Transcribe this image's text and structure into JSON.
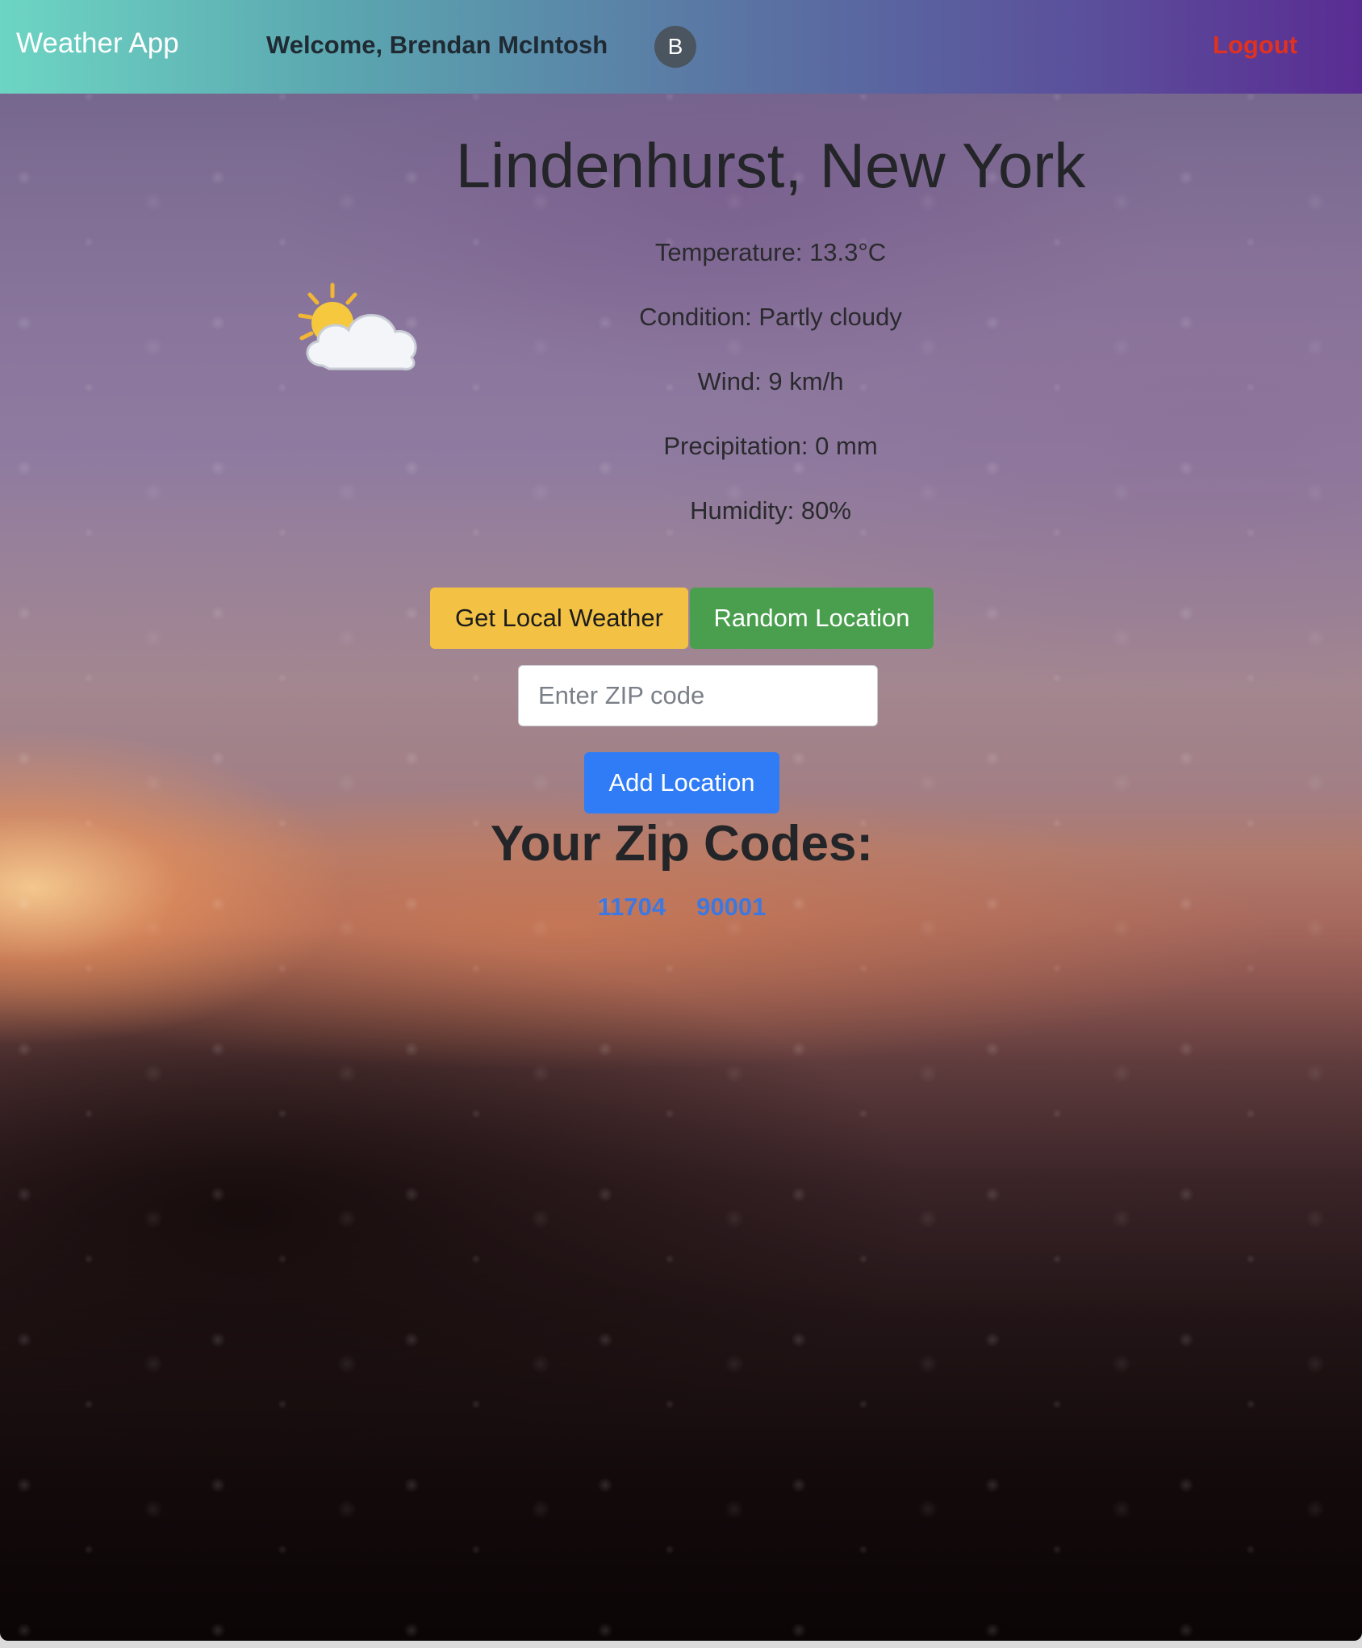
{
  "nav": {
    "brand": "Weather App",
    "welcome": "Welcome, Brendan McIntosh",
    "avatar_initial": "B",
    "logout_label": "Logout"
  },
  "weather": {
    "location": "Lindenhurst, New York",
    "icon": "partly-cloudy-icon",
    "temperature": "Temperature: 13.3°C",
    "condition": "Condition: Partly cloudy",
    "wind": "Wind: 9 km/h",
    "precipitation": "Precipitation: 0 mm",
    "humidity": "Humidity: 80%"
  },
  "actions": {
    "local_label": "Get Local Weather",
    "random_label": "Random Location",
    "zip_placeholder": "Enter ZIP code",
    "zip_value": "",
    "add_label": "Add Location"
  },
  "zips": {
    "heading": "Your Zip Codes:",
    "items": [
      "11704",
      "90001"
    ]
  },
  "colors": {
    "nav_gradient_start": "#6dd5c3",
    "nav_gradient_end": "#5a2c93",
    "logout": "#e0321f",
    "local_button": "#f3c244",
    "random_button": "#4a9f4e",
    "add_button": "#2f7cf6",
    "zip_link": "#3d78e0"
  }
}
